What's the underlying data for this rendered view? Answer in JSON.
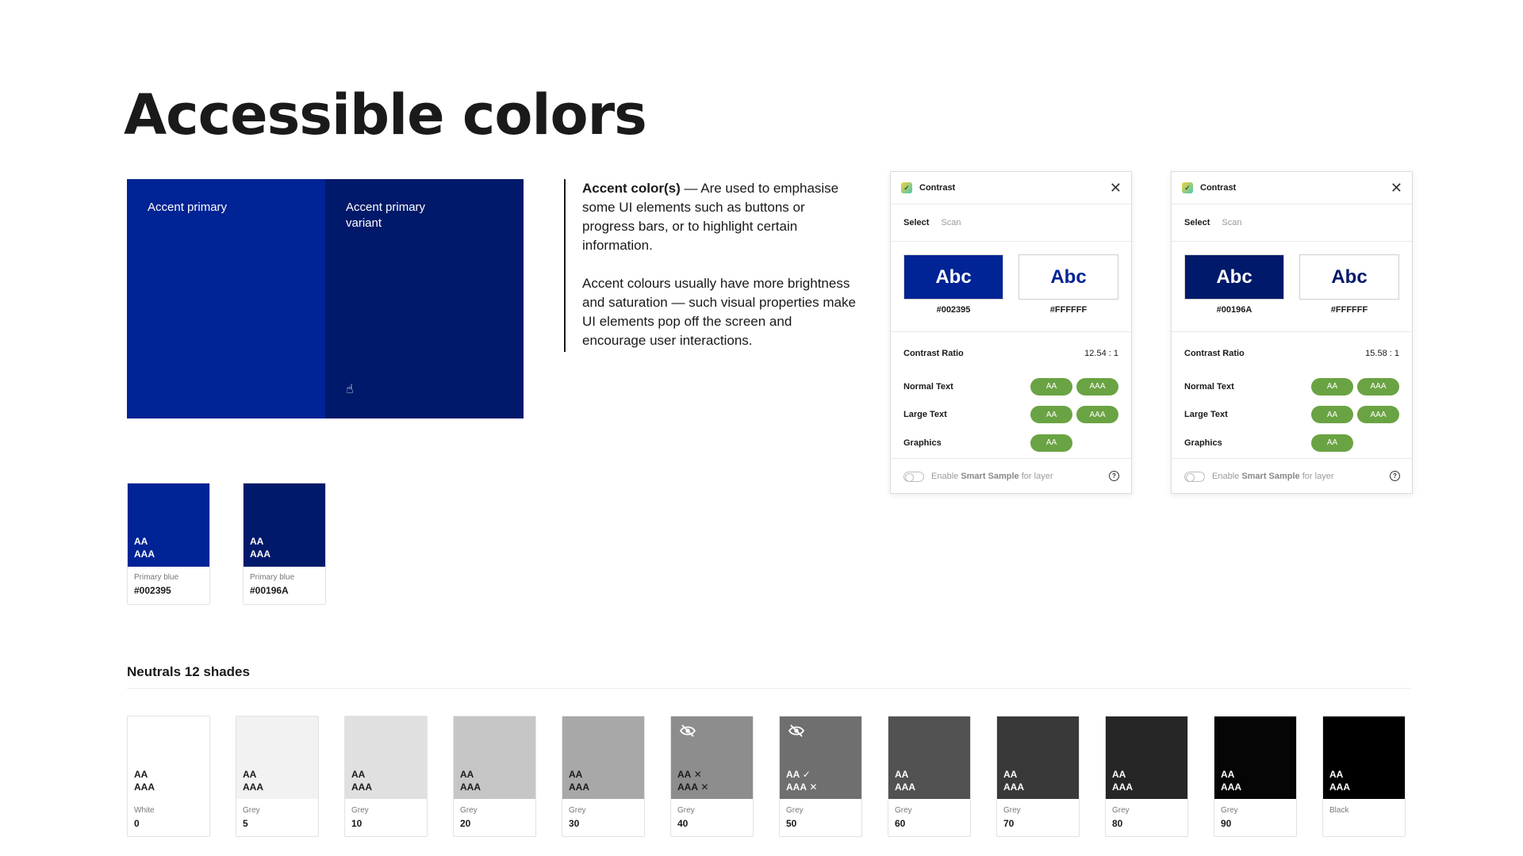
{
  "title": "Accessible colors",
  "accent_block": {
    "primary_label": "Accent primary",
    "variant_label": "Accent primary variant",
    "primary_color": "#002395",
    "variant_color": "#00196A"
  },
  "description": {
    "lead": "Accent color(s)",
    "para1": " — Are used to emphasise some UI elements such as buttons or progress bars, or to highlight certain information.",
    "para2": "Accent colours usually have more brightness and saturation — such visual properties make UI elements pop off the screen and encourage user interactions."
  },
  "swatches": [
    {
      "aa": "AA",
      "aaa": "AAA",
      "label": "Primary blue",
      "value": "#002395",
      "color": "#002395"
    },
    {
      "aa": "AA",
      "aaa": "AAA",
      "label": "Primary blue",
      "value": "#00196A",
      "color": "#00196A"
    }
  ],
  "panels": [
    {
      "title": "Contrast",
      "tab_select": "Select",
      "tab_scan": "Scan",
      "sample_text": "Abc",
      "fg_hex": "#002395",
      "bg_hex": "#FFFFFF",
      "fg_color": "#002395",
      "ratio_label": "Contrast Ratio",
      "ratio_value": "12.54 : 1",
      "normal_label": "Normal Text",
      "large_label": "Large Text",
      "graphics_label": "Graphics",
      "pill_aa": "AA",
      "pill_aaa": "AAA",
      "footer_pre": "Enable ",
      "footer_bold": "Smart Sample",
      "footer_post": " for layer"
    },
    {
      "title": "Contrast",
      "tab_select": "Select",
      "tab_scan": "Scan",
      "sample_text": "Abc",
      "fg_hex": "#00196A",
      "bg_hex": "#FFFFFF",
      "fg_color": "#00196A",
      "ratio_label": "Contrast Ratio",
      "ratio_value": "15.58 : 1",
      "normal_label": "Normal Text",
      "large_label": "Large Text",
      "graphics_label": "Graphics",
      "pill_aa": "AA",
      "pill_aaa": "AAA",
      "footer_pre": "Enable ",
      "footer_bold": "Smart Sample",
      "footer_post": " for layer"
    }
  ],
  "neutrals": {
    "title": "Neutrals 12 shades",
    "items": [
      {
        "aa": "AA",
        "aaa": "AAA",
        "label": "White",
        "value": "0",
        "color": "#FFFFFF",
        "text_color": "#1a1a1a",
        "hidden_icon": false,
        "aa_mark": "",
        "aaa_mark": ""
      },
      {
        "aa": "AA",
        "aaa": "AAA",
        "label": "Grey",
        "value": "5",
        "color": "#F2F2F2",
        "text_color": "#1a1a1a",
        "hidden_icon": false,
        "aa_mark": "",
        "aaa_mark": ""
      },
      {
        "aa": "AA",
        "aaa": "AAA",
        "label": "Grey",
        "value": "10",
        "color": "#E0E0E0",
        "text_color": "#1a1a1a",
        "hidden_icon": false,
        "aa_mark": "",
        "aaa_mark": ""
      },
      {
        "aa": "AA",
        "aaa": "AAA",
        "label": "Grey",
        "value": "20",
        "color": "#C6C6C6",
        "text_color": "#1a1a1a",
        "hidden_icon": false,
        "aa_mark": "",
        "aaa_mark": ""
      },
      {
        "aa": "AA",
        "aaa": "AAA",
        "label": "Grey",
        "value": "30",
        "color": "#A8A8A8",
        "text_color": "#1a1a1a",
        "hidden_icon": false,
        "aa_mark": "",
        "aaa_mark": ""
      },
      {
        "aa": "AA",
        "aaa": "AAA",
        "label": "Grey",
        "value": "40",
        "color": "#8D8D8D",
        "text_color": "#1a1a1a",
        "hidden_icon": true,
        "aa_mark": "✕",
        "aaa_mark": "✕"
      },
      {
        "aa": "AA",
        "aaa": "AAA",
        "label": "Grey",
        "value": "50",
        "color": "#6F6F6F",
        "text_color": "#ffffff",
        "hidden_icon": true,
        "aa_mark": "✓",
        "aaa_mark": "✕"
      },
      {
        "aa": "AA",
        "aaa": "AAA",
        "label": "Grey",
        "value": "60",
        "color": "#525252",
        "text_color": "#ffffff",
        "hidden_icon": false,
        "aa_mark": "",
        "aaa_mark": ""
      },
      {
        "aa": "AA",
        "aaa": "AAA",
        "label": "Grey",
        "value": "70",
        "color": "#393939",
        "text_color": "#ffffff",
        "hidden_icon": false,
        "aa_mark": "",
        "aaa_mark": ""
      },
      {
        "aa": "AA",
        "aaa": "AAA",
        "label": "Grey",
        "value": "80",
        "color": "#262626",
        "text_color": "#ffffff",
        "hidden_icon": false,
        "aa_mark": "",
        "aaa_mark": ""
      },
      {
        "aa": "AA",
        "aaa": "AAA",
        "label": "Grey",
        "value": "90",
        "color": "#050505",
        "text_color": "#ffffff",
        "hidden_icon": false,
        "aa_mark": "",
        "aaa_mark": ""
      },
      {
        "aa": "AA",
        "aaa": "AAA",
        "label": "Black",
        "value": "",
        "color": "#000000",
        "text_color": "#ffffff",
        "hidden_icon": false,
        "aa_mark": "",
        "aaa_mark": ""
      }
    ]
  }
}
